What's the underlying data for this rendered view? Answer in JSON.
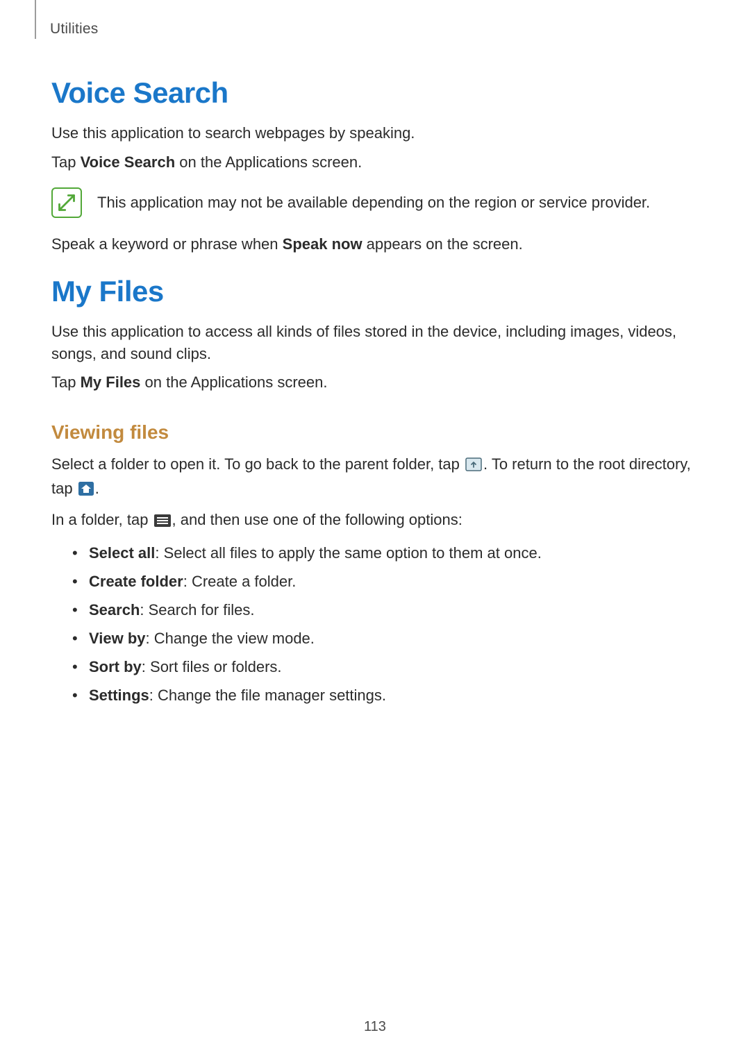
{
  "breadcrumb": "Utilities",
  "page_number": "113",
  "voice_search": {
    "heading": "Voice Search",
    "p1": "Use this application to search webpages by speaking.",
    "p2_pre": "Tap ",
    "p2_bold": "Voice Search",
    "p2_post": " on the Applications screen.",
    "note": "This application may not be available depending on the region or service provider.",
    "p3_pre": "Speak a keyword or phrase when ",
    "p3_bold": "Speak now",
    "p3_post": " appears on the screen."
  },
  "my_files": {
    "heading": "My Files",
    "p1": "Use this application to access all kinds of files stored in the device, including images, videos, songs, and sound clips.",
    "p2_pre": "Tap ",
    "p2_bold": "My Files",
    "p2_post": " on the Applications screen.",
    "viewing": {
      "heading": "Viewing files",
      "p1_a": "Select a folder to open it. To go back to the parent folder, tap ",
      "p1_b": ". To return to the root directory, tap ",
      "p1_c": ".",
      "p2_a": "In a folder, tap ",
      "p2_b": ", and then use one of the following options:",
      "options": [
        {
          "label": "Select all",
          "desc": ": Select all files to apply the same option to them at once."
        },
        {
          "label": "Create folder",
          "desc": ": Create a folder."
        },
        {
          "label": "Search",
          "desc": ": Search for files."
        },
        {
          "label": "View by",
          "desc": ": Change the view mode."
        },
        {
          "label": "Sort by",
          "desc": ": Sort files or folders."
        },
        {
          "label": "Settings",
          "desc": ": Change the file manager settings."
        }
      ]
    }
  }
}
